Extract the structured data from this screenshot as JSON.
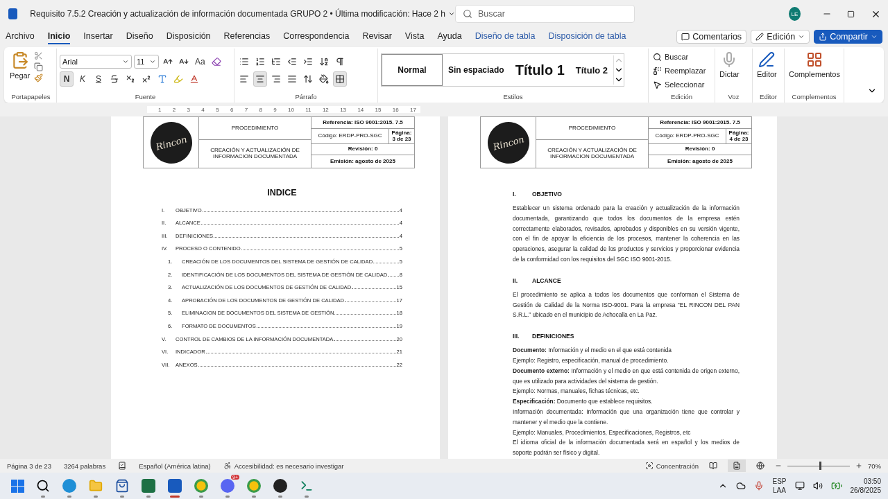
{
  "title_bar": {
    "document_title": "Requisito 7.5.2 Creación y actualización de información documentada GRUPO 2 • Última modificación: Hace 2 h",
    "search": {
      "placeholder": "Buscar"
    },
    "avatar": "LE"
  },
  "menu_tabs": [
    {
      "label": "Archivo",
      "selected": false,
      "kind": "standard"
    },
    {
      "label": "Inicio",
      "selected": true,
      "kind": "standard"
    },
    {
      "label": "Insertar",
      "selected": false,
      "kind": "standard"
    },
    {
      "label": "Diseño",
      "selected": false,
      "kind": "standard"
    },
    {
      "label": "Disposición",
      "selected": false,
      "kind": "standard"
    },
    {
      "label": "Referencias",
      "selected": false,
      "kind": "standard"
    },
    {
      "label": "Correspondencia",
      "selected": false,
      "kind": "standard"
    },
    {
      "label": "Revisar",
      "selected": false,
      "kind": "standard"
    },
    {
      "label": "Vista",
      "selected": false,
      "kind": "standard"
    },
    {
      "label": "Ayuda",
      "selected": false,
      "kind": "standard"
    },
    {
      "label": "Diseño de tabla",
      "selected": false,
      "kind": "contextual"
    },
    {
      "label": "Disposición de tabla",
      "selected": false,
      "kind": "contextual"
    }
  ],
  "actions": [
    {
      "label": "Comentarios",
      "kind": "comments"
    },
    {
      "label": "Edición",
      "kind": "mode"
    },
    {
      "label": "Compartir",
      "kind": "share"
    }
  ],
  "ribbon": {
    "clipboard": {
      "group": "Portapapeles",
      "paste": "Pegar"
    },
    "font": {
      "group": "Fuente",
      "family": "Arial",
      "size": "11",
      "case_label": "Aa",
      "styles": [
        {
          "label": "N",
          "selected": true
        },
        {
          "label": "K",
          "selected": false
        },
        {
          "label": "S",
          "selected": false
        }
      ]
    },
    "paragraph": {
      "group": "Párrafo",
      "alignments": [
        {
          "kind": "left",
          "selected": false
        },
        {
          "kind": "center",
          "selected": true
        },
        {
          "kind": "right",
          "selected": false
        },
        {
          "kind": "justify",
          "selected": false
        }
      ]
    },
    "styles": {
      "group": "Estilos",
      "items": [
        {
          "label": "Normal",
          "kind": "normal",
          "selected": true
        },
        {
          "label": "Sin espaciado",
          "kind": "nospacing",
          "selected": false
        },
        {
          "label": "Título 1",
          "kind": "heading1",
          "selected": false
        },
        {
          "label": "Título 2",
          "kind": "heading2",
          "selected": false
        }
      ]
    },
    "editing": {
      "group": "Edición",
      "items": [
        {
          "label": "Buscar",
          "kind": "find"
        },
        {
          "label": "Reemplazar",
          "kind": "replace"
        },
        {
          "label": "Seleccionar",
          "kind": "select"
        }
      ]
    },
    "voice": {
      "group": "Voz",
      "label": "Dictar"
    },
    "editor": {
      "group": "Editor",
      "label": "Editor"
    },
    "addins": {
      "group": "Complementos",
      "label": "Complementos"
    }
  },
  "ruler": [
    "1",
    "2",
    "3",
    "4",
    "5",
    "6",
    "7",
    "8",
    "9",
    "10",
    "11",
    "12",
    "13",
    "14",
    "15",
    "16",
    "17"
  ],
  "pages": [
    {
      "kind": "index",
      "header": {
        "logo_text": "Rincon",
        "type": "PROCEDIMIENTO",
        "title": "CREACIÓN Y ACTUALIZACIÓN DE INFORMACION DOCUMENTADA",
        "reference": "Referencia: ISO 9001:2015. 7.5",
        "code": "Código: ERDP-PRO-SGC",
        "page": "Página: 3 de 23",
        "revision": "Revisión: 0",
        "issued": "Emisión: agosto de 2025"
      },
      "title": "INDICE",
      "entries": [
        {
          "number": "I.",
          "title": "OBJETIVO",
          "page": "4"
        },
        {
          "number": "II.",
          "title": "ALCANCE",
          "page": "4"
        },
        {
          "number": "III.",
          "title": "DEFINICIONES",
          "page": "4"
        },
        {
          "number": "IV.",
          "title": "PROCESO O CONTENIDO",
          "page": "5",
          "children": [
            {
              "number": "1.",
              "title": "CREACIÓN DE LOS DOCUMENTOS DEL SISTEMA DE GESTIÓN DE CALIDAD",
              "page": "5"
            },
            {
              "number": "2.",
              "title": "IDENTIFICACIÓN DE LOS DOCUMENTOS DEL SISTEMA DE GESTIÓN DE CALIDAD",
              "page": "8"
            },
            {
              "number": "3.",
              "title": "ACTUALIZACIÓN DE LOS DOCUMENTOS DE GESTIÓN DE CALIDAD",
              "page": "15"
            },
            {
              "number": "4.",
              "title": "APROBACIÓN DE LOS DOCUMENTOS DE GESTIÓN DE CALIDAD",
              "page": "17"
            },
            {
              "number": "5.",
              "title": "ELIMINACION DE DOCUMENTOS DEL SISTEMA DE GESTIÓN",
              "page": "18"
            },
            {
              "number": "6.",
              "title": "FORMATO DE DOCUMENTOS",
              "page": "19"
            }
          ]
        },
        {
          "number": "V.",
          "title": "CONTROL DE CAMBIOS DE LA INFORMACIÓN DOCUMENTADA",
          "page": "20"
        },
        {
          "number": "VI.",
          "title": "INDICADOR",
          "page": "21"
        },
        {
          "number": "VII.",
          "title": "ANEXOS",
          "page": "22"
        }
      ]
    },
    {
      "kind": "body",
      "header": {
        "logo_text": "Rincon",
        "type": "PROCEDIMIENTO",
        "title": "CREACIÓN Y ACTUALIZACIÓN DE INFORMACION DOCUMENTADA",
        "reference": "Referencia: ISO 9001:2015. 7.5",
        "code": "Código: ERDP-PRO-SGC",
        "page": "Página: 4 de 23",
        "revision": "Revisión: 0",
        "issued": "Emisión: agosto de 2025"
      },
      "sections": [
        {
          "number": "I.",
          "heading": "OBJETIVO",
          "paragraphs": [
            "Establecer un sistema ordenado para la creación y actualización de la información documentada, garantizando que todos los documentos de la empresa estén correctamente elaborados, revisados, aprobados y disponibles en su versión vigente, con el fin de apoyar la eficiencia de los procesos, mantener la coherencia en las operaciones, asegurar la calidad de los productos y servicios y proporcionar evidencia de la conformidad con los requisitos del SGC ISO 9001-2015."
          ]
        },
        {
          "number": "II.",
          "heading": "ALCANCE",
          "paragraphs": [
            "El procedimiento se aplica a todos los documentos que conforman el Sistema de Gestión de Calidad de la Norma ISO-9001. Para la empresa “EL RINCON DEL PAN S.R.L.” ubicado en el municipio de Achocalla en La Paz."
          ]
        },
        {
          "number": "III.",
          "heading": "DEFINICIONES",
          "paragraphs": [
            "**Documento:** Información y el medio en el que está contenida",
            "Ejemplo: Registro, especificación, manual de procedimiento.",
            "**Documento externo:** Información y el medio en que está contenida de origen externo, que es utilizado para actividades del sistema de gestión.",
            "Ejemplo: Normas, manuales, fichas técnicas, etc.",
            "**Especificación:** Documento que establece requisitos.",
            "Información documentada: Información que una organización tiene que controlar y mantener y el medio que la contiene.",
            "Ejemplo: Manuales, Procedimientos, Especificaciones, Registros, etc",
            "El idioma oficial de la información documentada será en español y los medios de soporte podrán ser físico y digital."
          ]
        }
      ]
    }
  ],
  "status_bar": {
    "page": "Página 3 de 23",
    "words": "3264 palabras",
    "language": "Español (América latina)",
    "accessibility": "Accesibilidad: es necesario investigar",
    "focus": "Concentración",
    "views": [
      {
        "kind": "read",
        "selected": false
      },
      {
        "kind": "print",
        "selected": true
      },
      {
        "kind": "web",
        "selected": false
      }
    ],
    "zoom": {
      "level": 0.52,
      "label": "70%"
    }
  },
  "taskbar": {
    "apps": [
      {
        "kind": "search",
        "selected": false
      },
      {
        "kind": "edge",
        "selected": false
      },
      {
        "kind": "folder",
        "selected": false
      },
      {
        "kind": "store",
        "selected": false
      },
      {
        "kind": "excel",
        "selected": false
      },
      {
        "kind": "word",
        "selected": true
      },
      {
        "kind": "chrome",
        "selected": false
      },
      {
        "kind": "discord",
        "selected": false,
        "badge": "9+"
      },
      {
        "kind": "chrome",
        "selected": false
      },
      {
        "kind": "obs",
        "selected": false
      },
      {
        "kind": "terminal",
        "selected": false
      }
    ],
    "tray": {
      "language": "ESP",
      "region": "LAA",
      "time": "03:50",
      "date": "26/8/2025"
    }
  }
}
